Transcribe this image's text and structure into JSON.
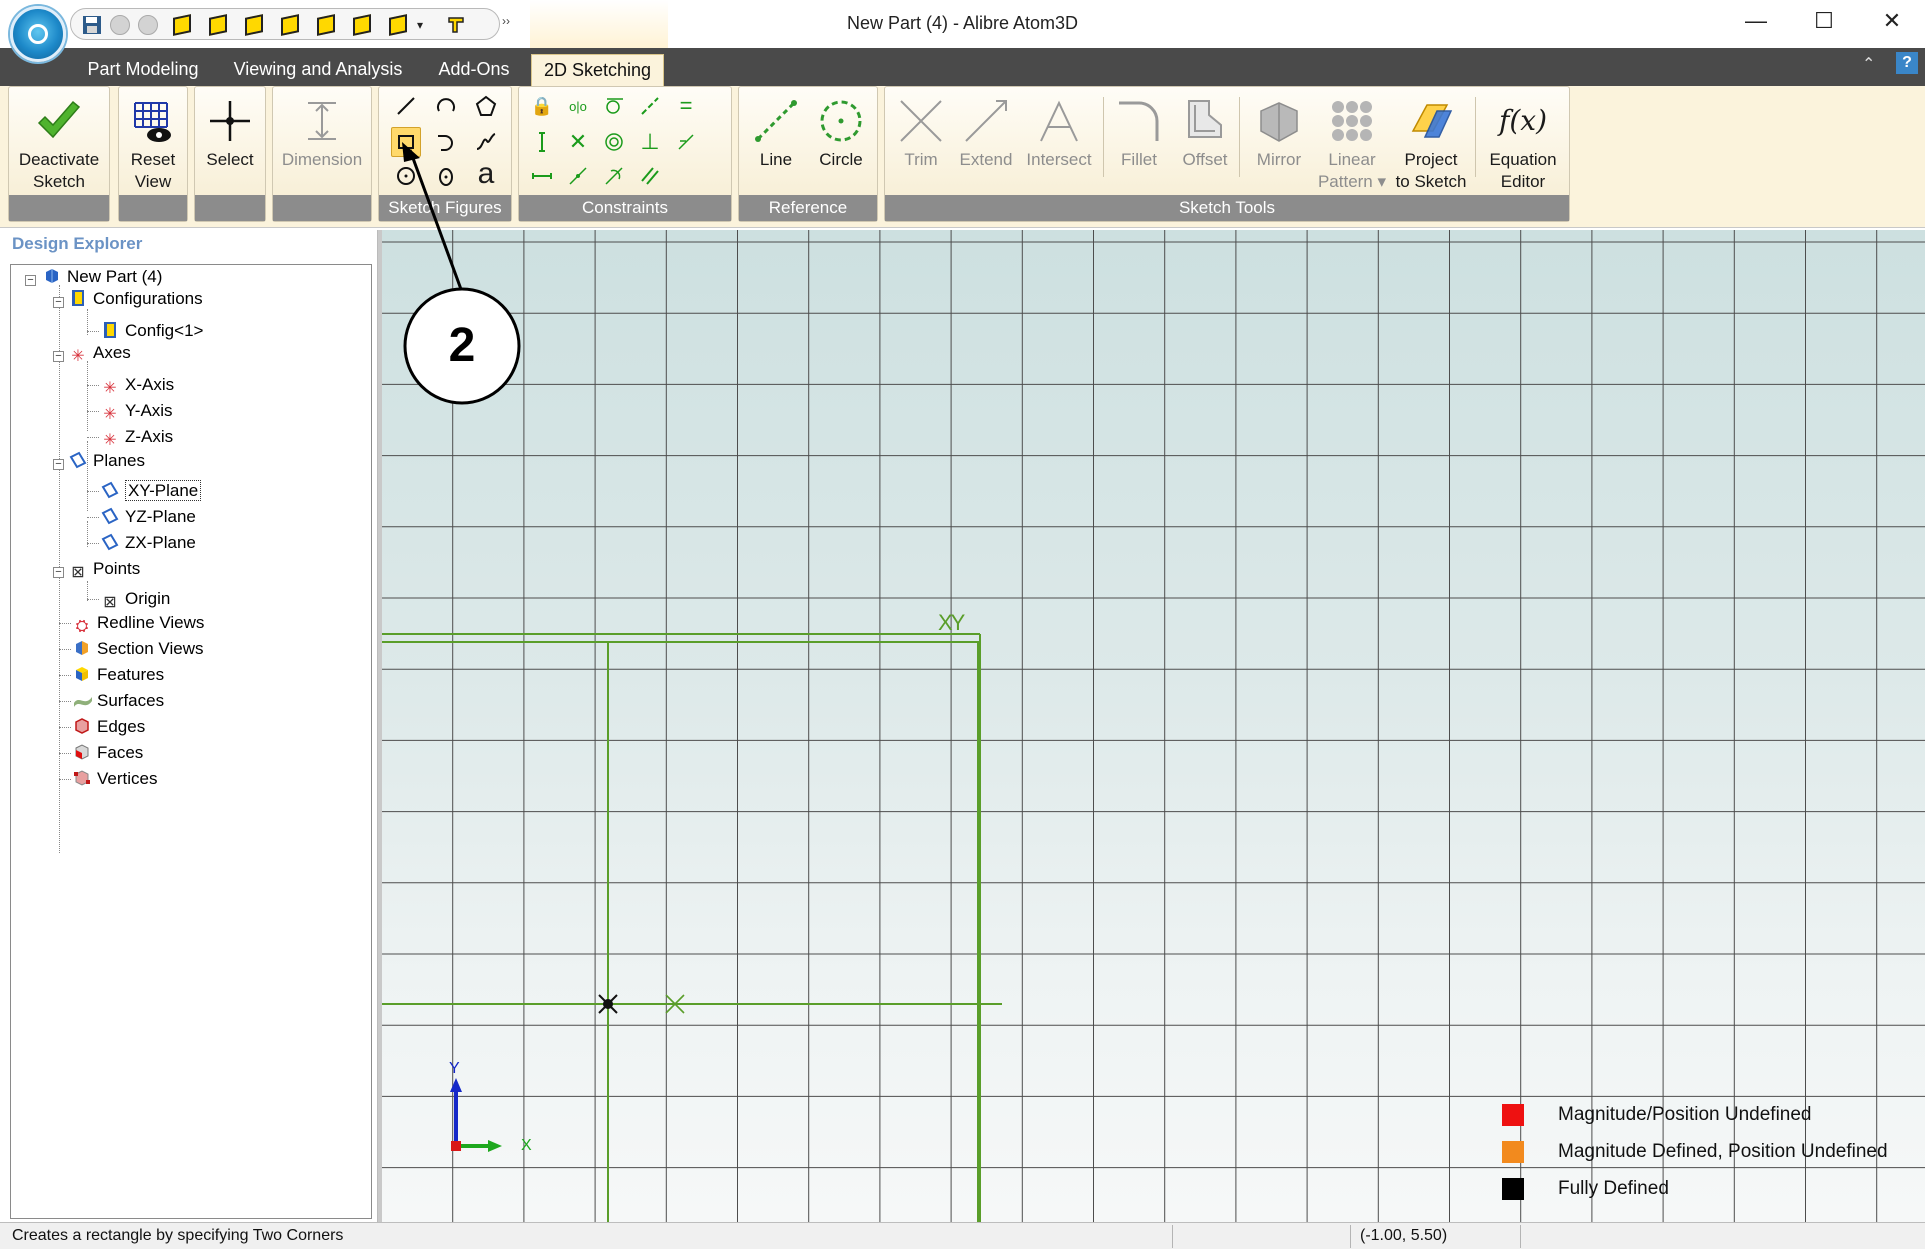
{
  "window": {
    "title": "New Part (4) - Alibre Atom3D",
    "minimize": "—",
    "maximize": "☐",
    "close": "✕"
  },
  "ribbon_tabs": [
    {
      "label": "Part Modeling"
    },
    {
      "label": "Viewing and Analysis"
    },
    {
      "label": "Add-Ons"
    },
    {
      "label": "2D Sketching",
      "active": true
    }
  ],
  "ribbon": {
    "deactivate_sketch": "Deactivate\nSketch",
    "reset_view": "Reset\nView",
    "select": "Select",
    "dimension": "Dimension",
    "sketch_figures_label": "Sketch Figures",
    "constraints_label": "Constraints",
    "reference_label": "Reference",
    "sketch_tools_label": "Sketch Tools",
    "line": "Line",
    "circle": "Circle",
    "trim": "Trim",
    "extend": "Extend",
    "intersect": "Intersect",
    "fillet": "Fillet",
    "offset": "Offset",
    "mirror": "Mirror",
    "linear_pattern": "Linear\nPattern ▾",
    "project_to_sketch": "Project\nto Sketch",
    "equation_editor": "Equation\nEditor",
    "equation_glyph": "f(x)",
    "text_glyph": "a"
  },
  "explorer": {
    "title": "Design Explorer",
    "items": {
      "part": "New Part (4)",
      "configurations": "Configurations",
      "config1": "Config<1>",
      "axes": "Axes",
      "x_axis": "X-Axis",
      "y_axis": "Y-Axis",
      "z_axis": "Z-Axis",
      "planes": "Planes",
      "xy_plane": "XY-Plane",
      "yz_plane": "YZ-Plane",
      "zx_plane": "ZX-Plane",
      "points": "Points",
      "origin": "Origin",
      "redline_views": "Redline Views",
      "section_views": "Section Views",
      "features": "Features",
      "surfaces": "Surfaces",
      "edges": "Edges",
      "faces": "Faces",
      "vertices": "Vertices"
    }
  },
  "viewport": {
    "plane_label": "XY",
    "axis_x": "X",
    "axis_y": "Y",
    "callout_number": "2"
  },
  "legend": [
    {
      "label": "Magnitude/Position Undefined",
      "color": "#ee1111"
    },
    {
      "label": "Magnitude Defined, Position Undefined",
      "color": "#f28a1e"
    },
    {
      "label": "Fully Defined",
      "color": "#000000"
    }
  ],
  "status": {
    "message": "Creates a rectangle by specifying Two Corners",
    "coordinates": "(-1.00, 5.50)"
  },
  "colors": {
    "sketch_line": "#5a9e2a",
    "ribbon_bg": "#fbf3dc",
    "tab_bar": "#4a4a4a",
    "highlight": "#ffd96b"
  }
}
